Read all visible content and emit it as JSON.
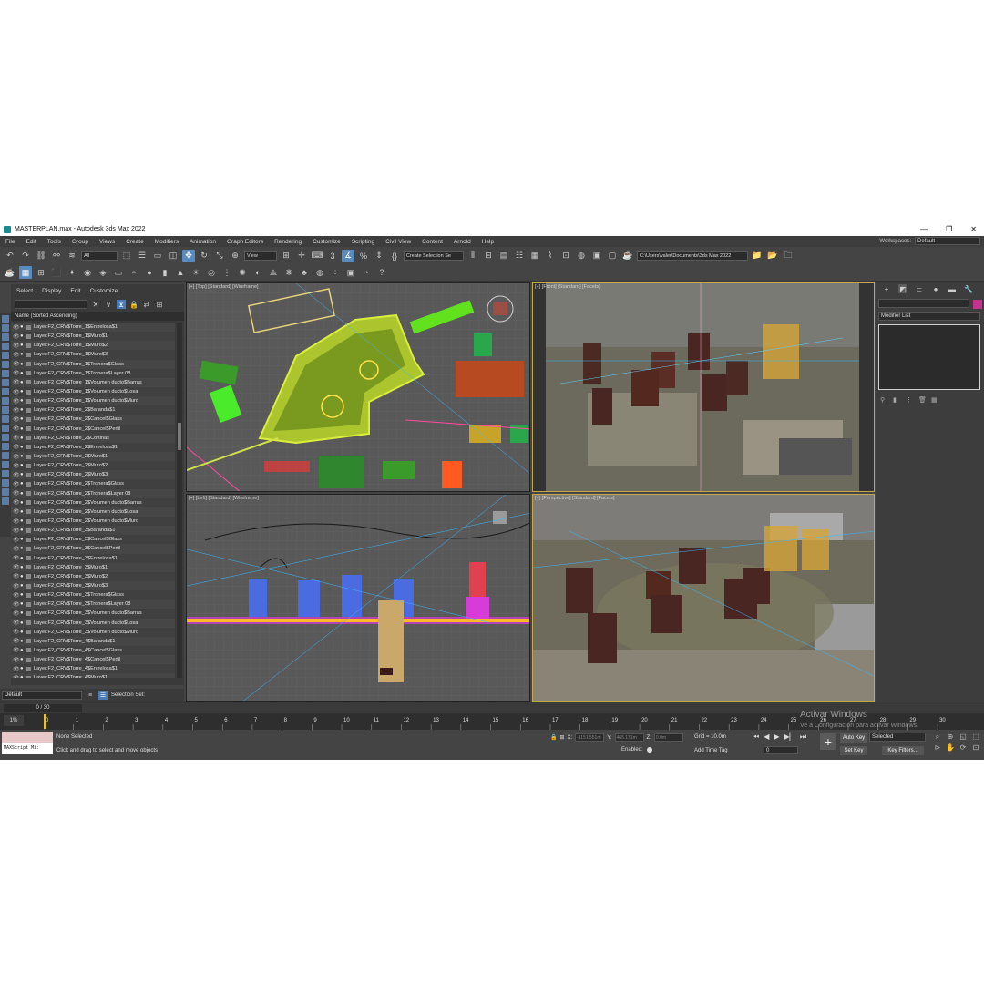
{
  "window": {
    "title": "MASTERPLAN.max - Autodesk 3ds Max 2022",
    "controls": [
      "—",
      "❐",
      "✕"
    ]
  },
  "menu": [
    "File",
    "Edit",
    "Tools",
    "Group",
    "Views",
    "Create",
    "Modifiers",
    "Animation",
    "Graph Editors",
    "Rendering",
    "Customize",
    "Scripting",
    "Civil View",
    "Content",
    "Arnold",
    "Help"
  ],
  "workspaces": {
    "label": "Workspaces:",
    "value": "Default"
  },
  "toolbar": {
    "filter": "All",
    "ref_coord": "View",
    "selection_set": "Create Selection Se",
    "project_path": "C:\\Users\\valer\\Documents\\3ds Max 2022"
  },
  "explorer": {
    "menu": [
      "Select",
      "Display",
      "Edit",
      "Customize"
    ],
    "header": "Name (Sorted Ascending)",
    "rows": [
      "Layer:F2_CRV$Torre_1$Entrelosa$1",
      "Layer:F2_CRV$Torre_1$Muro$1",
      "Layer:F2_CRV$Torre_1$Muro$2",
      "Layer:F2_CRV$Torre_1$Muro$3",
      "Layer:F2_CRV$Torre_1$Tronera$Glass",
      "Layer:F2_CRV$Torre_1$Tronera$Layer 08",
      "Layer:F2_CRV$Torre_1$Volumen ducto$Barras",
      "Layer:F2_CRV$Torre_1$Volumen ducto$Losa",
      "Layer:F2_CRV$Torre_1$Volumen ducto$Muro",
      "Layer:F2_CRV$Torre_2$Baranda$1",
      "Layer:F2_CRV$Torre_2$Cancel$Glass",
      "Layer:F2_CRV$Torre_2$Cancel$Perfil",
      "Layer:F2_CRV$Torre_2$Cortinas",
      "Layer:F2_CRV$Torre_2$Entrelosa$1",
      "Layer:F2_CRV$Torre_2$Muro$1",
      "Layer:F2_CRV$Torre_2$Muro$2",
      "Layer:F2_CRV$Torre_2$Muro$3",
      "Layer:F2_CRV$Torre_2$Tronera$Glass",
      "Layer:F2_CRV$Torre_2$Tronera$Layer 08",
      "Layer:F2_CRV$Torre_2$Volumen ducto$Barras",
      "Layer:F2_CRV$Torre_2$Volumen ducto$Losa",
      "Layer:F2_CRV$Torre_2$Volumen ducto$Muro",
      "Layer:F2_CRV$Torre_3$Baranda$1",
      "Layer:F2_CRV$Torre_3$Cancel$Glass",
      "Layer:F2_CRV$Torre_3$Cancel$Perfil",
      "Layer:F2_CRV$Torre_3$Entrelosa$1",
      "Layer:F2_CRV$Torre_3$Muro$1",
      "Layer:F2_CRV$Torre_3$Muro$2",
      "Layer:F2_CRV$Torre_3$Muro$3",
      "Layer:F2_CRV$Torre_3$Tronera$Glass",
      "Layer:F2_CRV$Torre_3$Tronera$Layer 08",
      "Layer:F2_CRV$Torre_3$Volumen ducto$Barras",
      "Layer:F2_CRV$Torre_3$Volumen ducto$Losa",
      "Layer:F2_CRV$Torre_3$Volumen ducto$Muro",
      "Layer:F2_CRV$Torre_4$Baranda$1",
      "Layer:F2_CRV$Torre_4$Cancel$Glass",
      "Layer:F2_CRV$Torre_4$Cancel$Perfil",
      "Layer:F2_CRV$Torre_4$Entrelosa$1",
      "Layer:F2_CRV$Torre_4$Muro$1"
    ],
    "layer_dropdown": "Default",
    "selection_set_label": "Selection Set:"
  },
  "viewports": {
    "top": "[+] [Top] [Standard] [Wireframe]",
    "front": "[+] [Front] [Standard] [Facets]",
    "left": "[+] [Left] [Standard] [Wireframe]",
    "perspective": "[+] [Perspective] [Standard] [Facets]"
  },
  "command_panel": {
    "modifier_list": "Modifier List",
    "object_color": "#c5318f"
  },
  "timeline": {
    "slider": "0 / 30",
    "ticks": [
      "0",
      "1",
      "2",
      "3",
      "4",
      "5",
      "6",
      "7",
      "8",
      "9",
      "10",
      "11",
      "12",
      "13",
      "14",
      "15",
      "16",
      "17",
      "18",
      "19",
      "20",
      "21",
      "22",
      "23",
      "24",
      "25",
      "26",
      "27",
      "28",
      "29",
      "30"
    ]
  },
  "status": {
    "maxscript": "MAXScript Mi:",
    "selection": "None Selected",
    "prompt": "Click and drag to select and move objects",
    "x_label": "X:",
    "x": "-1151.551m",
    "y_label": "Y:",
    "y": "465.171m",
    "z_label": "Z:",
    "z": "0.0m",
    "grid": "Grid = 10.0m",
    "enabled": "Enabled:",
    "add_time_tag": "Add Time Tag",
    "frame": "0",
    "auto_key": "Auto Key",
    "set_key": "Set Key",
    "selected": "Selected",
    "key_filters": "Key Filters..."
  },
  "watermark": {
    "line1": "Activar Windows",
    "line2": "Ve a Configuración para activar Windows."
  }
}
